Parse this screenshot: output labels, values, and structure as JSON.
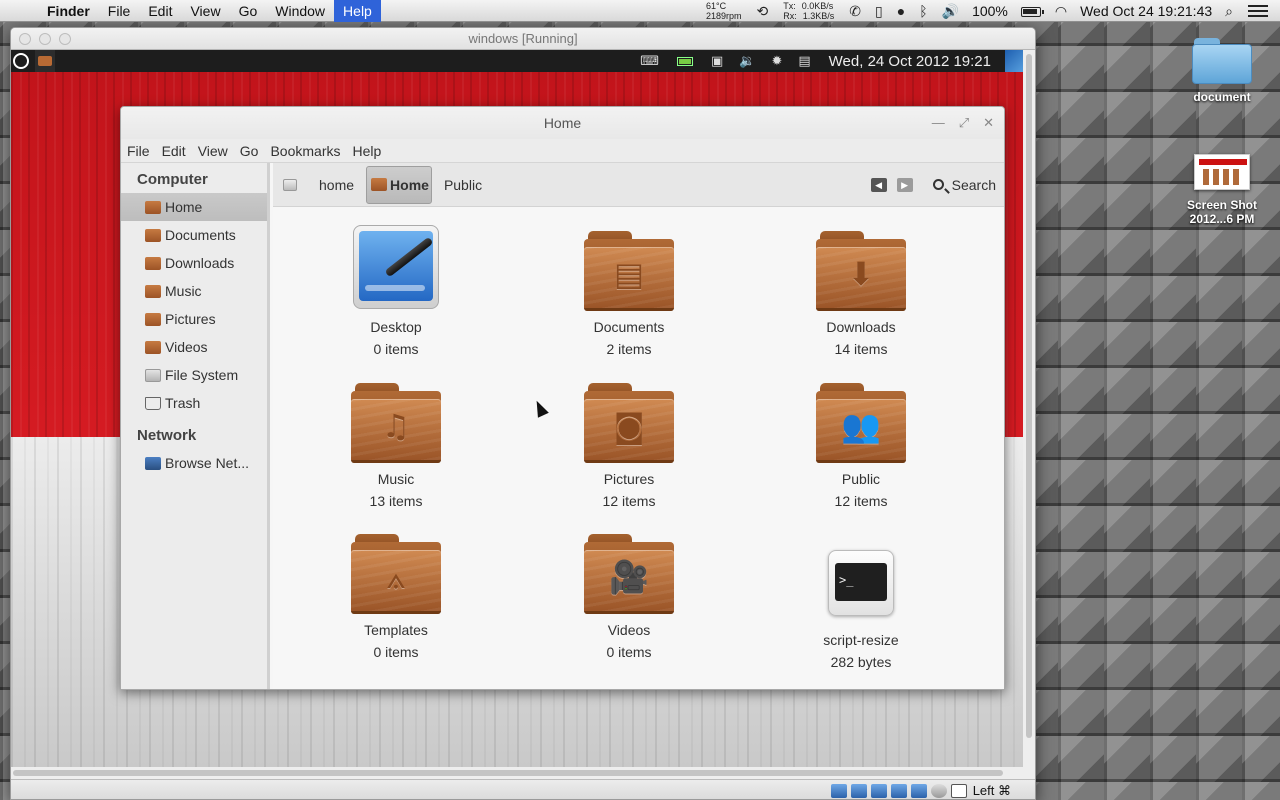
{
  "mac_menubar": {
    "app_name": "Finder",
    "menus": [
      "File",
      "Edit",
      "View",
      "Go",
      "Window",
      "Help"
    ],
    "active_menu": "Help",
    "temp": "61°C",
    "rpm": "2189rpm",
    "tx_label": "Tx:",
    "tx_value": "0.0KB/s",
    "rx_label": "Rx:",
    "rx_value": "1.3KB/s",
    "battery_percent": "100%",
    "datetime": "Wed Oct 24  19:21:43"
  },
  "desktop_icons": [
    {
      "label": "document"
    },
    {
      "label": "Screen Shot 2012...6 PM"
    }
  ],
  "vbox": {
    "title": "windows [Running]",
    "host_key": "Left ⌘"
  },
  "guest_panel": {
    "clock": "Wed, 24 Oct 2012 19:21"
  },
  "nautilus": {
    "title": "Home",
    "menus": [
      "File",
      "Edit",
      "View",
      "Go",
      "Bookmarks",
      "Help"
    ],
    "sidebar": {
      "computer_heading": "Computer",
      "computer_items": [
        {
          "label": "Home",
          "active": true,
          "icon": "folder"
        },
        {
          "label": "Documents",
          "icon": "folder"
        },
        {
          "label": "Downloads",
          "icon": "folder"
        },
        {
          "label": "Music",
          "icon": "folder"
        },
        {
          "label": "Pictures",
          "icon": "folder"
        },
        {
          "label": "Videos",
          "icon": "folder"
        },
        {
          "label": "File System",
          "icon": "drive"
        },
        {
          "label": "Trash",
          "icon": "trash"
        }
      ],
      "network_heading": "Network",
      "network_items": [
        {
          "label": "Browse Net...",
          "icon": "network"
        }
      ]
    },
    "breadcrumbs": [
      "home",
      "Home",
      "Public"
    ],
    "current_crumb": "Home",
    "search_label": "Search",
    "items": [
      {
        "name": "Desktop",
        "count": "0 items",
        "icon": "desktop-app"
      },
      {
        "name": "Documents",
        "count": "2 items",
        "icon": "folder-documents"
      },
      {
        "name": "Downloads",
        "count": "14 items",
        "icon": "folder-downloads"
      },
      {
        "name": "Music",
        "count": "13 items",
        "icon": "folder-music"
      },
      {
        "name": "Pictures",
        "count": "12 items",
        "icon": "folder-pictures"
      },
      {
        "name": "Public",
        "count": "12 items",
        "icon": "folder-public"
      },
      {
        "name": "Templates",
        "count": "0 items",
        "icon": "folder-templates"
      },
      {
        "name": "Videos",
        "count": "0 items",
        "icon": "folder-videos"
      },
      {
        "name": "script-resize",
        "count": "282 bytes",
        "icon": "terminal"
      }
    ]
  }
}
